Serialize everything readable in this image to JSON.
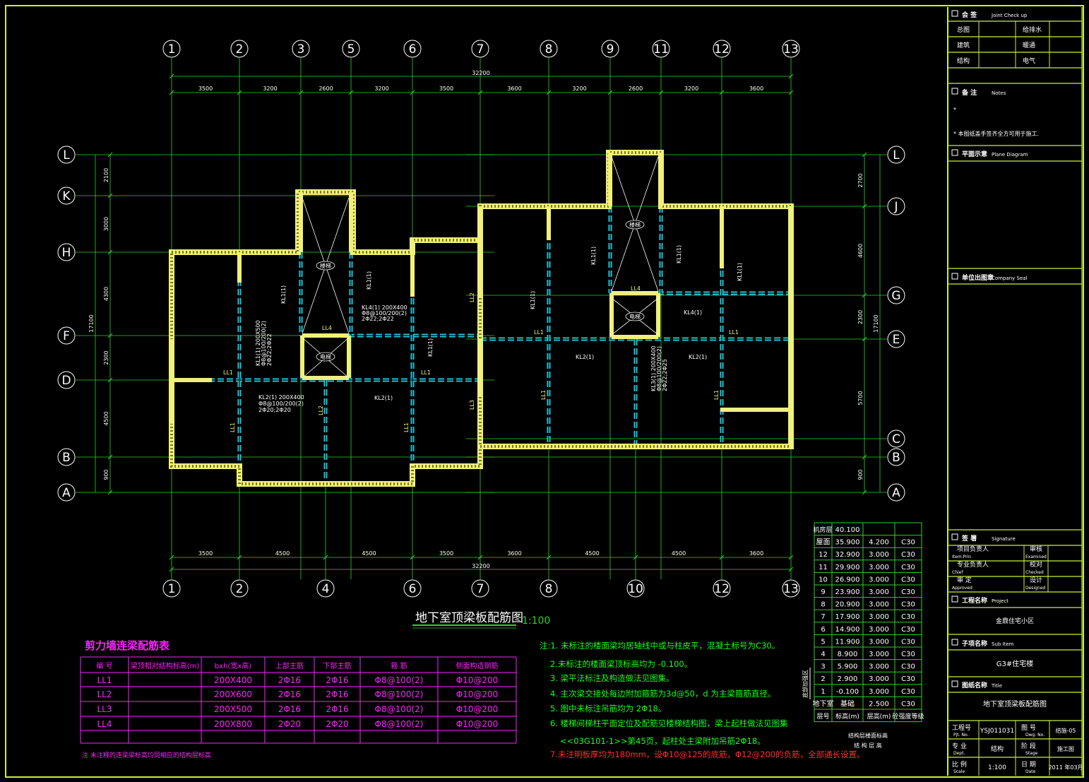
{
  "drawing": {
    "title": "地下室顶梁板配筋图",
    "scale": "1:100",
    "colors": {
      "background": "#000000",
      "frame": "#c8f03c",
      "axis": "#2ed12e",
      "wall": "#f0f07a",
      "beam": "#1ec8dc",
      "text": "#ffffff",
      "magenta": "#ff22ff",
      "note": "#19ff19",
      "note_red": "#ff3030"
    },
    "top_axes": [
      "1",
      "2",
      "3",
      "5",
      "6",
      "7",
      "8",
      "9",
      "11",
      "12",
      "13"
    ],
    "bottom_axes": [
      "1",
      "2",
      "4",
      "6",
      "7",
      "8",
      "10",
      "12",
      "13"
    ],
    "left_axes": [
      "L",
      "K",
      "H",
      "F",
      "D",
      "B",
      "A"
    ],
    "right_axes": [
      "L",
      "J",
      "G",
      "E",
      "C",
      "B",
      "A"
    ],
    "top_total": "32200",
    "top_dims": [
      "3500",
      "3200",
      "2600",
      "3200",
      "3500",
      "3600",
      "3200",
      "2600",
      "3200",
      "3600"
    ],
    "bottom_total": "32200",
    "bottom_dims": [
      "3500",
      "4500",
      "4500",
      "3500",
      "3600",
      "4500",
      "4500",
      "3600"
    ],
    "left_total": "17100",
    "left_dims": [
      "2100",
      "3000",
      "4300",
      "2300",
      "4500",
      "900"
    ],
    "right_total": "17100",
    "right_dims": [
      "2700",
      "4600",
      "2300",
      "5700",
      "900"
    ],
    "labels": {
      "stair_l": "楼梯",
      "stair_r": "楼梯",
      "elev_l": "电梯",
      "elev_r": "电梯",
      "kl1_1": "KL1(1)",
      "kl1_2": "KL1(1)",
      "kl1_3": "KL1(1)",
      "kl1_4": "KL1(1)",
      "kl1_5": "KL1(1)",
      "kl1_6": "KL1(1)",
      "kl1_7": "KL1(1)",
      "kl2_1": "KL2(1)",
      "kl2_2": "KL2(1)",
      "kl2_3": "KL2(1)",
      "kl4_1": "KL4(1)",
      "ll1_1": "LL1",
      "ll1_2": "LL1",
      "ll1_3": "LL1",
      "ll1_4": "LL1",
      "ll1_5": "LL1",
      "ll1_6": "LL1",
      "ll1_7": "LL1",
      "ll1_8": "LL1",
      "ll1_9": "LL1",
      "ll2_1": "LL2",
      "ll2_2": "LL2",
      "ll3_1": "LL3",
      "ll4_1": "LL4",
      "ll4_2": "LL4",
      "kl4_a": "KL4(1) 200X400",
      "kl4_b": "Φ8@100/200(2)",
      "kl4_c": "2Φ22;2Φ22",
      "kl1_a": "KL1(1) 200X500",
      "kl1_b": "Φ8@100/200(2)",
      "kl1_c": "2Φ22;2Φ22",
      "kl2_a": "KL2(1) 200X400",
      "kl2_b": "Φ8@100/200(2)",
      "kl2_c": "2Φ20;2Φ20",
      "kl3_a": "KL3(1) 200X400",
      "kl3_b": "Φ8@100/200(2)",
      "kl3_c": "2Φ22;2Φ25"
    }
  },
  "beam_table": {
    "title": "剪力墙连梁配筋表",
    "headers": [
      "编 号",
      "梁顶相对结构标高(m)",
      "bxh(宽x高)",
      "上部主筋",
      "下部主筋",
      "箍 筋",
      "侧面构造钢筋"
    ],
    "rows": [
      [
        "LL1",
        "",
        "200X400",
        "2Φ16",
        "2Φ16",
        "Φ8@100(2)",
        "Φ10@200"
      ],
      [
        "LL2",
        "",
        "200X600",
        "2Φ16",
        "2Φ16",
        "Φ8@100(2)",
        "Φ10@200"
      ],
      [
        "LL3",
        "",
        "200X500",
        "2Φ16",
        "2Φ16",
        "Φ8@100(2)",
        "Φ10@200"
      ],
      [
        "LL4",
        "",
        "200X800",
        "2Φ20",
        "2Φ20",
        "Φ8@100(2)",
        "Φ10@200"
      ],
      [
        "",
        "",
        "",
        "",
        "",
        "",
        ""
      ]
    ],
    "note": "注 未注释的连梁梁标高均同相应的结构层标高"
  },
  "notes": [
    "注:1. 未标注的楼面梁均居轴线中或与柱皮平，混凝土标号为C30。",
    "2.未标注的楼面梁顶标高均为 -0.100。",
    "3. 梁平法标注及构造做法见图集。",
    "4. 主次梁交接处每边附加箍筋为3d@50，d 为主梁箍筋直径。",
    "5. 图中未标注吊筋均为 2Φ18。",
    "6. 楼梯间梯柱平面定位及配筋见楼梯结构图，梁上起柱做法见图集",
    "<<03G101-1>>第45页，起柱处主梁附加吊筋2Φ18。",
    "7.未注明板厚均为180mm，设Φ10@125的底筋，Φ12@200的负筋，全部通长设置。"
  ],
  "floor_table": {
    "roof_label": "机房层",
    "roof_elev": "40.100",
    "rows": [
      [
        "屋面",
        "35.900",
        "4.200",
        "C30"
      ],
      [
        "12",
        "32.900",
        "3.000",
        "C30"
      ],
      [
        "11",
        "29.900",
        "3.000",
        "C30"
      ],
      [
        "10",
        "26.900",
        "3.000",
        "C30"
      ],
      [
        "9",
        "23.900",
        "3.000",
        "C30"
      ],
      [
        "8",
        "20.900",
        "3.000",
        "C30"
      ],
      [
        "7",
        "17.900",
        "3.000",
        "C30"
      ],
      [
        "6",
        "14.900",
        "3.000",
        "C30"
      ],
      [
        "5",
        "11.900",
        "3.000",
        "C30"
      ],
      [
        "4",
        "8.900",
        "3.000",
        "C30"
      ],
      [
        "3",
        "5.900",
        "3.000",
        "C30"
      ],
      [
        "2",
        "2.900",
        "3.000",
        "C30"
      ],
      [
        "1",
        "-0.100",
        "3.000",
        "C30"
      ],
      [
        "地下室",
        "基础",
        "2.500",
        "C30"
      ]
    ],
    "footer": [
      "层号",
      "标高(m)",
      "层高(m)",
      "砼强度等级"
    ],
    "side_label": "底部加强区",
    "caption1": "结构层楼面标高",
    "caption2": "结 构 层 高"
  },
  "title_block": {
    "joint_label": "会 签",
    "joint_en": "Joint Check up",
    "joint_rows": [
      [
        "总图",
        "",
        "给排水",
        ""
      ],
      [
        "建筑",
        "",
        "暖通",
        ""
      ],
      [
        "结构",
        "",
        "电气",
        ""
      ]
    ],
    "notes_label": "备 注",
    "notes_en": "Notes",
    "notes_text": "* 本图纸盖手签齐全方可用于施工.",
    "notes_star": "*",
    "plane_label": "平面示意",
    "plane_en": "Plane Diagram",
    "seal_label": "单位出图章",
    "seal_en": "Company Seal",
    "sign_label": "签 署",
    "sign_en": "Signature",
    "sign_rows": [
      [
        "项目负责人",
        "Item.Prin",
        "审核",
        "Examined"
      ],
      [
        "专业负责人",
        "Chief",
        "校对",
        "Checked"
      ],
      [
        "审 定",
        "Approved",
        "设计",
        "Designed"
      ]
    ],
    "project_label": "工程名称",
    "project_en": "Project",
    "project_value": "金鼎住宅小区",
    "subitem_label": "子项名称",
    "subitem_en": "Sub Item",
    "subitem_value": "G3#住宅楼",
    "title_label": "图纸名称",
    "title_en": "Title",
    "title_value": "地下室顶梁板配筋图",
    "proj_no_label": "工程号",
    "proj_no_en": "Pjt. No.",
    "proj_no_value": "YSJ011031",
    "dwg_no_label": "图 号",
    "dwg_no_en": "Dwg. No.",
    "dwg_no_value": "结施-05",
    "dept_label": "专 业",
    "dept_en": "Dept.",
    "dept_value": "结构",
    "stage_label": "阶 段",
    "stage_en": "Stage",
    "stage_value": "施工图",
    "scale_label": "比 例",
    "scale_en": "Scale",
    "scale_value": "1:100",
    "date_label": "日 期",
    "date_en": "Date",
    "date_value": "2011 年03月"
  }
}
